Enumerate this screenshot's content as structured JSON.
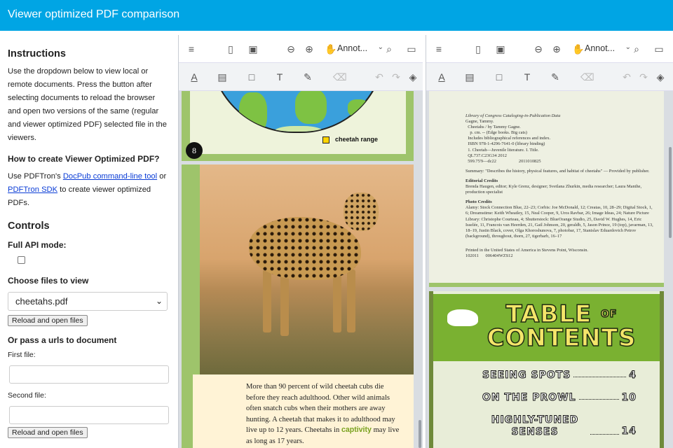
{
  "header": {
    "title": "Viewer optimized PDF comparison"
  },
  "sidebar": {
    "instructions_heading": "Instructions",
    "instructions_text": "Use the dropdown below to view local or remote documents. Press the button after selecting documents to reload the browser and open two versions of the same (regular and viewer optimized PDF) selected file in the viewers.",
    "how_heading": "How to create Viewer Optimized PDF?",
    "how_prefix": "Use PDFTron's ",
    "how_link1": "DocPub command-line tool",
    "how_middle": " or ",
    "how_link2": "PDFTron SDK",
    "how_suffix": " to create viewer optimized PDFs.",
    "controls_heading": "Controls",
    "full_api_label": "Full API mode:",
    "full_api_checked": false,
    "choose_label": "Choose files to view",
    "file_select_value": "cheetahs.pdf",
    "reload_button": "Reload and open files",
    "url_heading": "Or pass a urls to document",
    "first_file_label": "First file:",
    "second_file_label": "Second file:",
    "reload_button2": "Reload and open files"
  },
  "viewer": {
    "annot_label": "Annot...",
    "chevron": "⌄",
    "icons": {
      "menu": "≡",
      "panel": "▯",
      "file": "▣",
      "zoom_out": "⊖",
      "zoom_in": "⊕",
      "pan": "✋",
      "search": "⌕",
      "comment": "▭",
      "underline": "A",
      "text_box": "▤",
      "rect": "□",
      "text": "T",
      "pen": "✎",
      "eraser_shape": "⌫",
      "undo": "↶",
      "redo": "↷",
      "eraser": "◈"
    }
  },
  "page_left": {
    "map_legend": "cheetah range",
    "page_number": "8",
    "body_text": "More than 90 percent of wild cheetah cubs die before they reach adulthood. Other wild animals often snatch cubs when their mothers are away hunting. A cheetah that makes it to adulthood may live up to 12 years. Cheetahs in ",
    "body_highlight": "captivity",
    "body_end": " may live as long as 17 years."
  },
  "page_right": {
    "cip_lines": [
      "Library of Congress Cataloging-in-Publication Data",
      "Gagne, Tammy.",
      "  Cheetahs / by Tammy Gagne.",
      "    p. cm. -- (Edge books. Big cats)",
      "  Includes bibliographical references and index.",
      "  ISBN 978-1-4296-7641-0 (library binding)",
      "  1. Cheetah—Juvenile literature. I. Title.",
      "  QL737.C23G34 2012",
      "  599.75'9—dc22                    2011010825"
    ],
    "summary": "Summary: \"Describes the history, physical features, and habitat of cheetahs\" — Provided by publisher.",
    "editorial_heading": "Editorial Credits",
    "editorial_text": "Brenda Haugen, editor; Kyle Grenz, designer; Svetlana Zhurkin, media researcher; Laura Manthe, production specialist",
    "photo_heading": "Photo Credits",
    "photo_text": "Alamy: Stock Connection Blue, 22–23; Corbis: Joe McDonald, 12; Creatas, 10, 28–29; Digital Stock, 1, 6; Dreamstime: Keith Wheatley, 15, Neal Cooper, 9, Uros Ravbar, 26; Image Ideas, 24; Nature Picture Library: Christophe Courteau, 4; Shutterstock: BlueOrange Studio, 25, David W. Hughes, 14, Eric Isselée, 11, Francois van Heerden, 21, Gail Johnson, 20, geraldb, 5, Jason Prince, 19 (top), javarman, 13, 18–19, Justin Black, cover, Olga Khoroshunova, 7, photobar, 17, Stanislav Eduardovich Petrov (background), throughout, thorn, 27, tigerbarb, 16–17",
    "printed": "Printed in the United States of America in Stevens Point, Wisconsin.",
    "print_code": "102011      006404WZS12",
    "toc_title_1": "TABLE",
    "toc_of": "OF",
    "toc_title_2": "CONTENTS",
    "toc_rows": [
      {
        "label": "SEEING SPOTS",
        "page": "4"
      },
      {
        "label": "ON THE PROWL",
        "page": "10"
      },
      {
        "label": "HIGHLY-TUNED SENSES",
        "page": "14"
      }
    ]
  }
}
